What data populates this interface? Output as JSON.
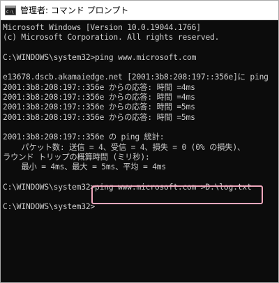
{
  "window": {
    "title": "管理者: コマンド プロンプト",
    "icon": "cmd-icon"
  },
  "console": {
    "lines": [
      "Microsoft Windows [Version 10.0.19044.1766]",
      "(c) Microsoft Corporation. All rights reserved.",
      "",
      "C:\\WINDOWS\\system32>ping www.microsoft.com",
      "",
      "e13678.dscb.akamaiedge.net [2001:3b8:208:197::356e]に ping",
      "2001:3b8:208:197::356e からの応答: 時間 =4ms",
      "2001:3b8:208:197::356e からの応答: 時間 =4ms",
      "2001:3b8:208:197::356e からの応答: 時間 =5ms",
      "2001:3b8:208:197::356e からの応答: 時間 =5ms",
      "",
      "2001:3b8:208:197::356e の ping 統計:",
      "    パケット数: 送信 = 4、受信 = 4、損失 = 0 (0% の損失)、",
      "ラウンド トリップの概算時間 (ミリ秒):",
      "    最小 = 4ms、最大 = 5ms、平均 = 4ms",
      "",
      "C:\\WINDOWS\\system32>ping www.microsoft.com >D:\\log.txt",
      "",
      "C:\\WINDOWS\\system32>"
    ]
  },
  "colors": {
    "background": "#0c0c0c",
    "text": "#cccccc",
    "highlight": "#f0a8bd"
  }
}
